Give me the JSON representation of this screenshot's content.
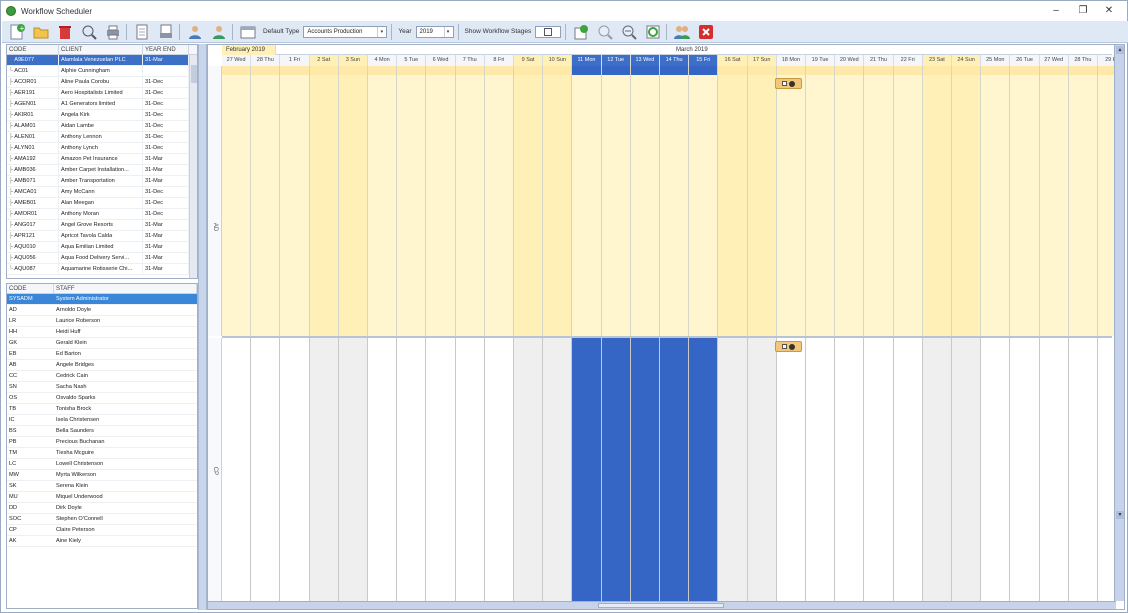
{
  "window": {
    "title": "Workflow Scheduler"
  },
  "toolbar": {
    "default_type_label": "Default Type",
    "default_type_value": "Accounts Production",
    "year_label": "Year",
    "year_value": "2019",
    "stages_label": "Show Workflow Stages"
  },
  "clients": {
    "headers": [
      "CODE",
      "CLIENT",
      "YEAR END"
    ],
    "rows": [
      {
        "code": "A9E077",
        "client": "Alamlala Venezuelan PLC",
        "ye": "31-Mar",
        "tree": "├"
      },
      {
        "code": "AC01",
        "client": "Alphie Cunningham",
        "ye": "",
        "tree": "└"
      },
      {
        "code": "ACOR01",
        "client": "Aline Paula Corobu",
        "ye": "31-Dec",
        "tree": "├"
      },
      {
        "code": "AER191",
        "client": "Aero Hospitalists Limited",
        "ye": "31-Dec",
        "tree": "├"
      },
      {
        "code": "AGEN01",
        "client": "A1 Generators limited",
        "ye": "31-Dec",
        "tree": "├"
      },
      {
        "code": "AKIR01",
        "client": "Angela Kirk",
        "ye": "31-Dec",
        "tree": "├"
      },
      {
        "code": "ALAM01",
        "client": "Aidan Lambe",
        "ye": "31-Dec",
        "tree": "├"
      },
      {
        "code": "ALEN01",
        "client": "Anthony Lennon",
        "ye": "31-Dec",
        "tree": "├"
      },
      {
        "code": "ALYN01",
        "client": "Anthony Lynch",
        "ye": "31-Dec",
        "tree": "├"
      },
      {
        "code": "AMA192",
        "client": "Amazon Pet Insurance",
        "ye": "31-Mar",
        "tree": "├"
      },
      {
        "code": "AMB036",
        "client": "Amber Carpet Installation...",
        "ye": "31-Mar",
        "tree": "├"
      },
      {
        "code": "AMB071",
        "client": "Amber Transportation",
        "ye": "31-Mar",
        "tree": "├"
      },
      {
        "code": "AMCA01",
        "client": "Amy McCann",
        "ye": "31-Dec",
        "tree": "├"
      },
      {
        "code": "AMEB01",
        "client": "Alan Meegan",
        "ye": "31-Dec",
        "tree": "├"
      },
      {
        "code": "AMOR01",
        "client": "Anthony Moran",
        "ye": "31-Dec",
        "tree": "├"
      },
      {
        "code": "ANG017",
        "client": "Angel Grove Resorts",
        "ye": "31-Mar",
        "tree": "├"
      },
      {
        "code": "APR121",
        "client": "Apricot Tavola Calda",
        "ye": "31-Mar",
        "tree": "├"
      },
      {
        "code": "AQU010",
        "client": "Aqua Emilian Limited",
        "ye": "31-Mar",
        "tree": "├"
      },
      {
        "code": "AQU056",
        "client": "Aqua Food Delivery Servi...",
        "ye": "31-Mar",
        "tree": "├"
      },
      {
        "code": "AQU087",
        "client": "Aquamarine Rotisserie Chi...",
        "ye": "31-Mar",
        "tree": "└"
      }
    ]
  },
  "staff": {
    "headers": [
      "CODE",
      "STAFF"
    ],
    "rows": [
      {
        "code": "SYSADM",
        "name": "System Administrator"
      },
      {
        "code": "AD",
        "name": "Arnoldo Doyle"
      },
      {
        "code": "LR",
        "name": "Laurice Roberson"
      },
      {
        "code": "HH",
        "name": "Heidi Huff"
      },
      {
        "code": "GK",
        "name": "Gerald Klein"
      },
      {
        "code": "EB",
        "name": "Ed Barton"
      },
      {
        "code": "AB",
        "name": "Angele Bridges"
      },
      {
        "code": "CC",
        "name": "Cedrick Cain"
      },
      {
        "code": "SN",
        "name": "Sacha Nash"
      },
      {
        "code": "OS",
        "name": "Osvaldo Sparks"
      },
      {
        "code": "TB",
        "name": "Tonisha Brock"
      },
      {
        "code": "IC",
        "name": "Isela Christensen"
      },
      {
        "code": "BS",
        "name": "Bella Saunders"
      },
      {
        "code": "PB",
        "name": "Precious Buchanan"
      },
      {
        "code": "TM",
        "name": "Tiesha Mcguire"
      },
      {
        "code": "LC",
        "name": "Lowell Christenson"
      },
      {
        "code": "MW",
        "name": "Myrta Wilkerson"
      },
      {
        "code": "SK",
        "name": "Serena Klein"
      },
      {
        "code": "MU",
        "name": "Miquel Underwood"
      },
      {
        "code": "DD",
        "name": "Dirk Doyle"
      },
      {
        "code": "SOC",
        "name": "Stephen O'Connell"
      },
      {
        "code": "CP",
        "name": "Claire Peterson"
      },
      {
        "code": "AK",
        "name": "Aine Kiely"
      }
    ]
  },
  "scheduler": {
    "months": [
      "February 2019",
      "March 2019"
    ],
    "days": [
      {
        "label": "27 Wed",
        "type": "wd"
      },
      {
        "label": "28 Thu",
        "type": "wd"
      },
      {
        "label": "1 Fri",
        "type": "wd"
      },
      {
        "label": "2 Sat",
        "type": "we"
      },
      {
        "label": "3 Sun",
        "type": "we"
      },
      {
        "label": "4 Mon",
        "type": "wd"
      },
      {
        "label": "5 Tue",
        "type": "wd"
      },
      {
        "label": "6 Wed",
        "type": "wd"
      },
      {
        "label": "7 Thu",
        "type": "wd"
      },
      {
        "label": "8 Fri",
        "type": "wd"
      },
      {
        "label": "9 Sat",
        "type": "we"
      },
      {
        "label": "10 Sun",
        "type": "we"
      },
      {
        "label": "11 Mon",
        "type": "hl"
      },
      {
        "label": "12 Tue",
        "type": "hl"
      },
      {
        "label": "13 Wed",
        "type": "hl"
      },
      {
        "label": "14 Thu",
        "type": "hl"
      },
      {
        "label": "15 Fri",
        "type": "hl"
      },
      {
        "label": "16 Sat",
        "type": "we"
      },
      {
        "label": "17 Sun",
        "type": "we"
      },
      {
        "label": "18 Mon",
        "type": "wd"
      },
      {
        "label": "19 Tue",
        "type": "wd"
      },
      {
        "label": "20 Wed",
        "type": "wd"
      },
      {
        "label": "21 Thu",
        "type": "wd"
      },
      {
        "label": "22 Fri",
        "type": "wd"
      },
      {
        "label": "23 Sat",
        "type": "we"
      },
      {
        "label": "24 Sun",
        "type": "we"
      },
      {
        "label": "25 Mon",
        "type": "wd"
      },
      {
        "label": "26 Tue",
        "type": "wd"
      },
      {
        "label": "27 Wed",
        "type": "wd"
      },
      {
        "label": "28 Thu",
        "type": "wd"
      },
      {
        "label": "29 Fri",
        "type": "wd"
      }
    ],
    "resources": [
      "AD",
      "CP"
    ]
  },
  "colors": {
    "accent": "#3c6fc6",
    "weekday_ad": "#fff6cf",
    "weekend_ad": "#fff0b8",
    "highlight": "#3566c5",
    "weekend_cp": "#efefef"
  }
}
